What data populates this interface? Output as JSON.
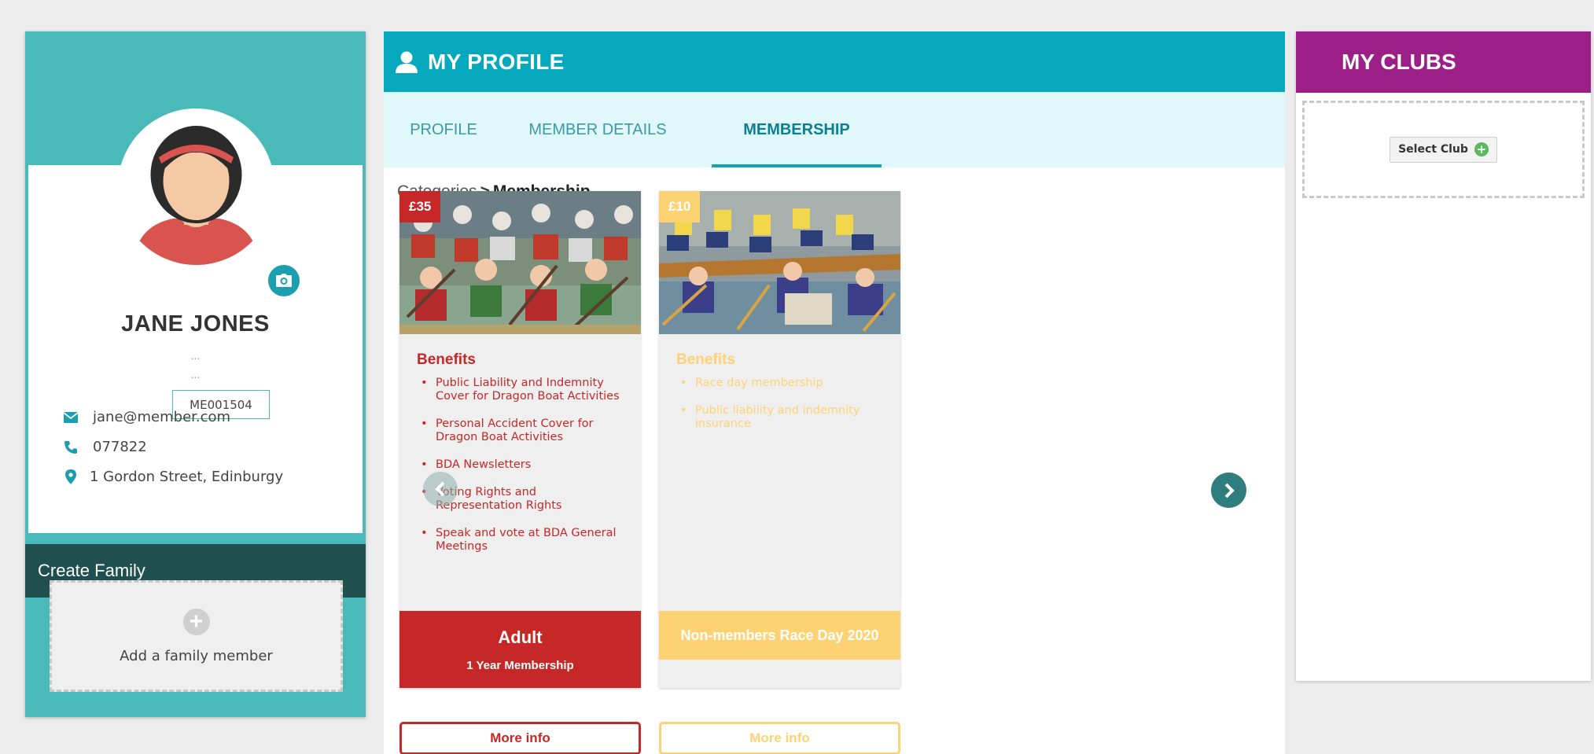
{
  "profile": {
    "name": "JANE JONES",
    "subtitle_1": "...",
    "subtitle_2": "...",
    "member_id": "ME001504",
    "email": "jane@member.com",
    "phone": "077822",
    "address": "1 Gordon Street, Edinburgy",
    "create_family_label": "Create Family",
    "add_family_label": "Add a family member"
  },
  "main": {
    "title": "MY PROFILE",
    "tabs": [
      {
        "label": "PROFILE",
        "active": false
      },
      {
        "label": "MEMBER DETAILS",
        "active": false
      },
      {
        "label": "MEMBERSHIP",
        "active": true
      }
    ],
    "breadcrumb": {
      "root": "Categories",
      "separator": ">",
      "current": "Membership"
    },
    "cards": [
      {
        "price": "£35",
        "benefits_title": "Benefits",
        "benefits": [
          "Public Liability and Indemnity Cover for Dragon Boat Activities",
          "Personal Accident Cover for Dragon Boat Activities",
          "BDA Newsletters",
          "Voting Rights and Representation Rights",
          "Speak and vote at BDA General Meetings"
        ],
        "name": "Adult",
        "subtitle": "1 Year Membership",
        "more_info": "More info",
        "color": "#c62828"
      },
      {
        "price": "£10",
        "benefits_title": "Benefits",
        "benefits": [
          "Race day membership",
          "Public liability and indemnity insurance"
        ],
        "name": "Non-members Race Day 2020",
        "subtitle": "",
        "more_info": "More info",
        "color": "#fdd273"
      }
    ]
  },
  "clubs": {
    "title": "MY CLUBS",
    "select_label": "Select Club"
  },
  "colors": {
    "teal_panel": "#4ab9b9",
    "header_teal": "#05a8bd",
    "dark_teal": "#1f4f4f",
    "clubs_purple": "#9b1f86",
    "tab_bg": "#e1f8fb"
  },
  "icons": {
    "header": "user-icon",
    "camera": "camera-icon",
    "email": "envelope-icon",
    "phone": "phone-icon",
    "address": "map-marker-icon",
    "add": "plus-icon",
    "prev": "chevron-left-icon",
    "next": "chevron-right-icon"
  }
}
